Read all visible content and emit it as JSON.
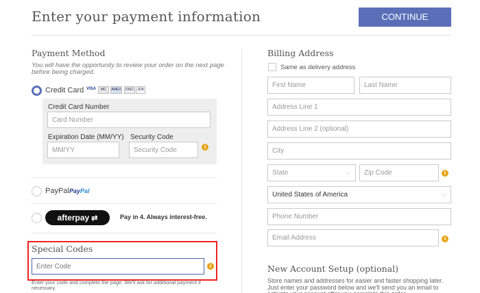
{
  "header": {
    "title": "Enter your payment information",
    "continue_label": "CONTINUE"
  },
  "payment": {
    "title": "Payment Method",
    "note": "You will have the opportunity to review your order on the next page before being charged.",
    "credit_card": {
      "label": "Credit Card",
      "card_logos": [
        "VISA",
        "MC",
        "AMEX",
        "DISC",
        "JCB"
      ],
      "number_label": "Credit Card Number",
      "number_placeholder": "Card Number",
      "exp_label": "Expiration Date (MM/YY)",
      "exp_placeholder": "MM/YY",
      "sec_label": "Security Code",
      "sec_placeholder": "Security Code"
    },
    "paypal": {
      "label": "PayPal",
      "logo_a": "Pay",
      "logo_b": "Pal"
    },
    "afterpay": {
      "logo": "afterpay",
      "arrow": "⇄",
      "text": "Pay in 4. Always interest-free."
    }
  },
  "special_codes": {
    "title": "Special Codes",
    "placeholder": "Enter Code",
    "note": "Enter your code and complete the page. We'll ask for additional payment if necessary."
  },
  "billing": {
    "title": "Billing Address",
    "same_label": "Same as delivery address",
    "first_name": "First Name",
    "last_name": "Last Name",
    "address1": "Address Line 1",
    "address2": "Address Line 2 (optional)",
    "city": "City",
    "state": "State",
    "zip": "Zip Code",
    "country": "United States of America",
    "phone": "Phone Number",
    "email": "Email Address"
  },
  "new_account": {
    "title": "New Account Setup (optional)",
    "note": "Store names and addresses for easier and faster shopping later. Just enter your password below and we'll send you an email to activate your account after you complete this order."
  },
  "icons": {
    "info": "i",
    "chevron": "⌵"
  },
  "colors": {
    "accent": "#5b6fb9",
    "info": "#e8a317",
    "highlight": "#e22222"
  }
}
